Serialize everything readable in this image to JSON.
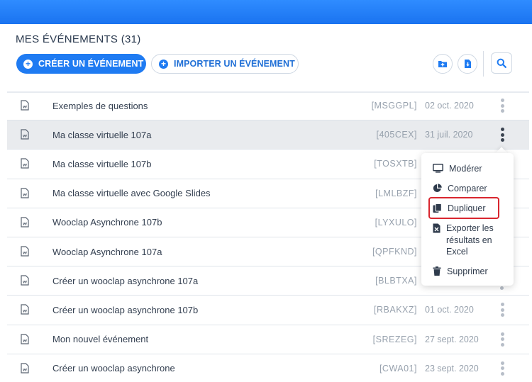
{
  "header": {
    "title": "MES ÉVÉNEMENTS (31)",
    "create_label": "CRÉER UN ÉVÉNEMENT",
    "import_label": "IMPORTER UN ÉVÉNEMENT",
    "icons": [
      "folder-plus-icon",
      "file-download-icon",
      "search-icon"
    ]
  },
  "events": [
    {
      "title": "Exemples de questions",
      "code": "[MSGGPL]",
      "date": "02 oct. 2020"
    },
    {
      "title": "Ma classe virtuelle 107a",
      "code": "[405CEX]",
      "date": "31 juil. 2020"
    },
    {
      "title": "Ma classe virtuelle 107b",
      "code": "[TOSXTB]",
      "date": ""
    },
    {
      "title": "Ma classe virtuelle avec Google Slides",
      "code": "[LMLBZF]",
      "date": ""
    },
    {
      "title": "Wooclap Asynchrone 107b",
      "code": "[LYXULO]",
      "date": ""
    },
    {
      "title": "Wooclap Asynchrone 107a",
      "code": "[QPFKND]",
      "date": ""
    },
    {
      "title": "Créer un wooclap asynchrone 107a",
      "code": "[BLBTXA]",
      "date": ""
    },
    {
      "title": "Créer un wooclap asynchrone 107b",
      "code": "[RBAKXZ]",
      "date": "01 oct. 2020"
    },
    {
      "title": "Mon nouvel événement",
      "code": "[SREZEG]",
      "date": "27 sept. 2020"
    },
    {
      "title": "Créer un wooclap asynchrone",
      "code": "[CWA01]",
      "date": "23 sept. 2020"
    }
  ],
  "context_menu": {
    "items": [
      {
        "label": "Modérer",
        "icon": "monitor-icon"
      },
      {
        "label": "Comparer",
        "icon": "pie-chart-icon"
      },
      {
        "label": "Dupliquer",
        "icon": "copy-icon"
      },
      {
        "label_lines": [
          "Exporter les",
          "résultats en",
          "Excel"
        ],
        "icon": "excel-icon"
      },
      {
        "label": "Supprimer",
        "icon": "trash-icon"
      }
    ],
    "highlighted": "Dupliquer",
    "highlight_color": "#d9262f"
  },
  "colors": {
    "accent": "#1f7bf2",
    "topbar": "#1a73f0",
    "selected_row": "#e9ebee"
  }
}
